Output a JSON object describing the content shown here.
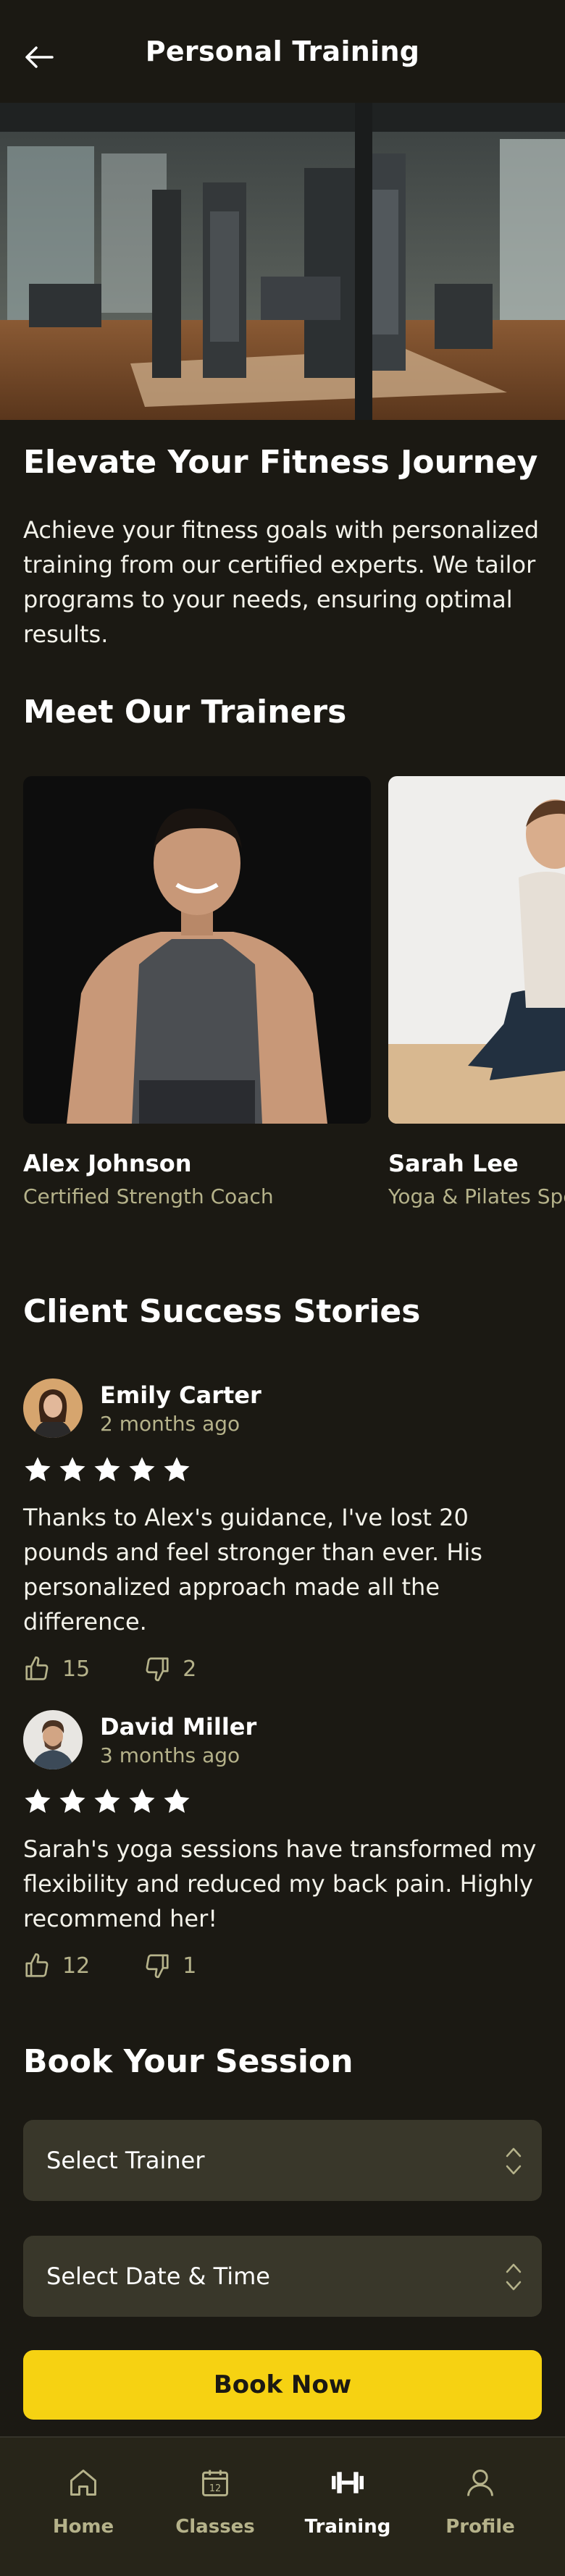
{
  "header": {
    "title": "Personal Training"
  },
  "intro": {
    "heading": "Elevate Your Fitness Journey",
    "text": "Achieve your fitness goals with personalized training from our certified experts. We tailor programs to your needs, ensuring optimal results."
  },
  "trainers": {
    "heading": "Meet Our Trainers",
    "items": [
      {
        "name": "Alex Johnson",
        "role": "Certified Strength Coach"
      },
      {
        "name": "Sarah Lee",
        "role": "Yoga & Pilates Specialist"
      }
    ]
  },
  "reviews": {
    "heading": "Client Success Stories",
    "items": [
      {
        "name": "Emily Carter",
        "time": "2 months ago",
        "rating": 5,
        "text": "Thanks to Alex's guidance, I've lost 20 pounds and feel stronger than ever. His personalized approach made all the difference.",
        "likes": "15",
        "dislikes": "2"
      },
      {
        "name": "David Miller",
        "time": "3 months ago",
        "rating": 5,
        "text": "Sarah's yoga sessions have transformed my flexibility and reduced my back pain. Highly recommend her!",
        "likes": "12",
        "dislikes": "1"
      }
    ]
  },
  "booking": {
    "heading": "Book Your Session",
    "trainer_select": "Select Trainer",
    "datetime_select": "Select Date & Time",
    "button": "Book Now"
  },
  "nav": {
    "items": [
      {
        "label": "Home",
        "icon": "home-icon"
      },
      {
        "label": "Classes",
        "icon": "calendar-icon"
      },
      {
        "label": "Training",
        "icon": "dumbbell-icon",
        "active": true
      },
      {
        "label": "Profile",
        "icon": "user-icon"
      }
    ]
  },
  "colors": {
    "background": "#1b1913",
    "accent": "#f6d212",
    "muted": "#b5b28a",
    "field": "#39372a"
  }
}
